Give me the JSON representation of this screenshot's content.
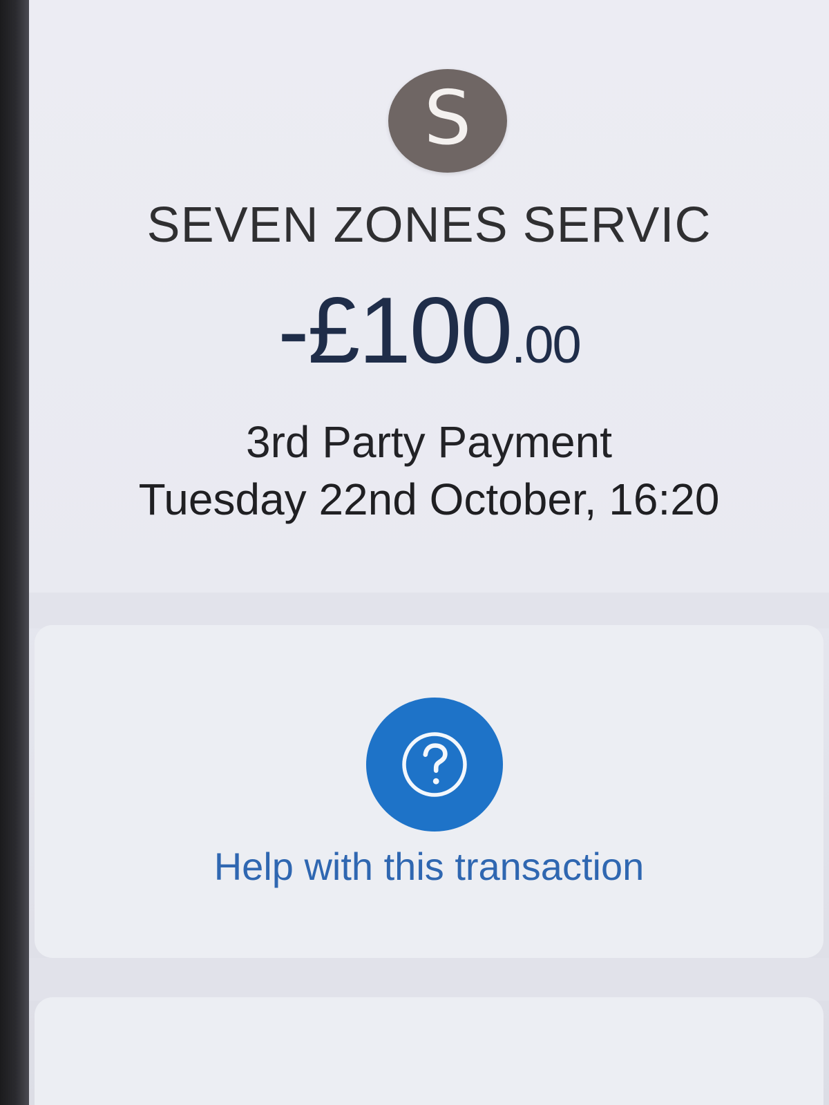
{
  "transaction": {
    "merchant_initial": "S",
    "merchant_name": "SEVEN ZONES SERVIC",
    "amount_sign": "-",
    "currency_symbol": "£",
    "amount_major": "100",
    "amount_minor": ".00",
    "type": "3rd Party Payment",
    "datetime": "Tuesday 22nd October, 16:20"
  },
  "help": {
    "label": "Help with this transaction",
    "icon": "question-mark-icon"
  },
  "colors": {
    "avatar_bg": "#6f6664",
    "amount_text": "#1f2d49",
    "help_blue": "#1e73c8",
    "link_blue": "#2f67b1"
  }
}
